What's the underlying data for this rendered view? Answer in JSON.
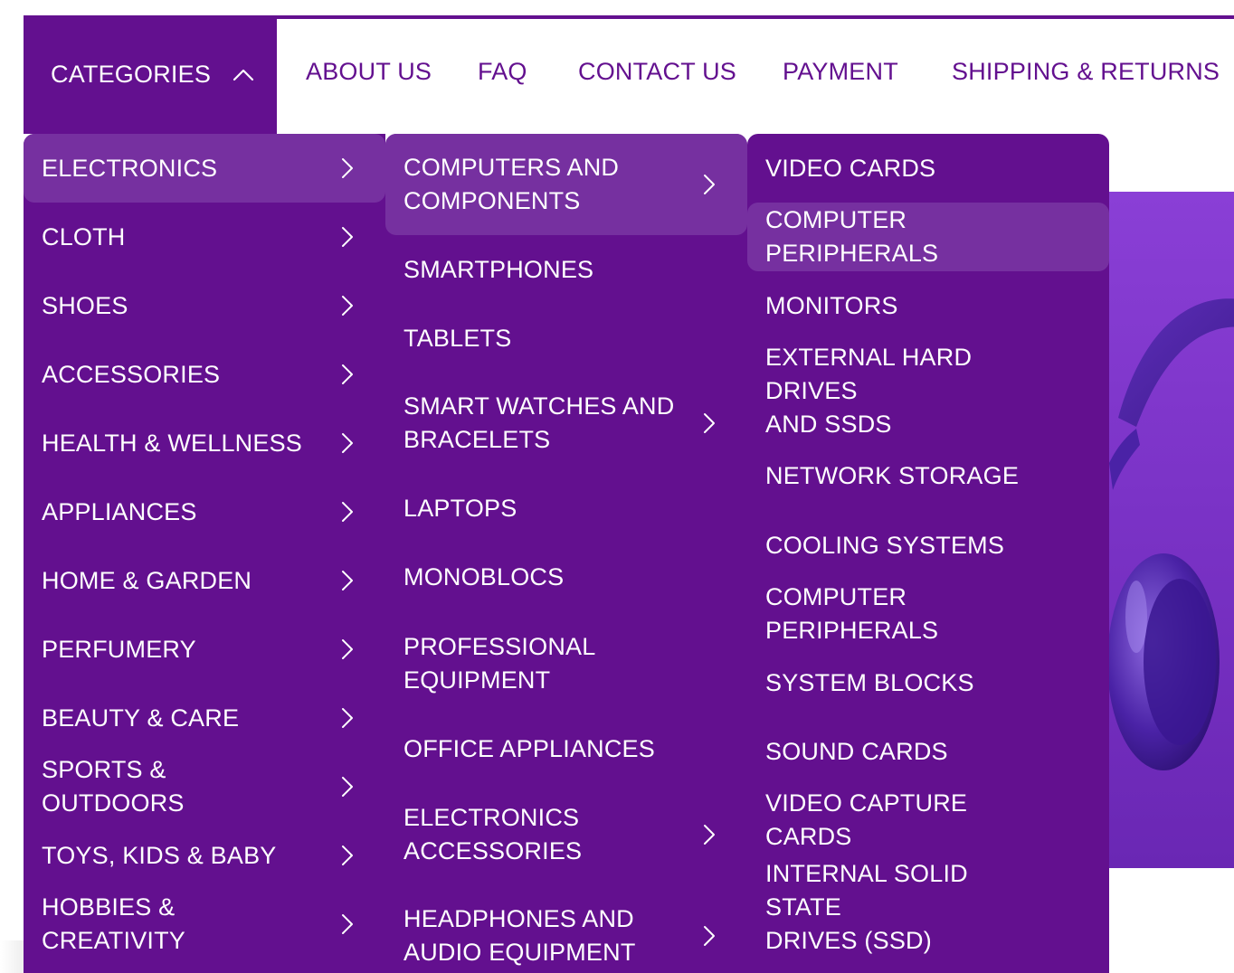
{
  "nav": {
    "categories_label": "CATEGORIES",
    "links": [
      "ABOUT US",
      "FAQ",
      "CONTACT US",
      "PAYMENT",
      "SHIPPING & RETURNS"
    ]
  },
  "menu_level1": {
    "items": [
      {
        "label": "ELECTRONICS",
        "has_submenu": true,
        "active": true
      },
      {
        "label": "CLOTH",
        "has_submenu": true
      },
      {
        "label": "SHOES",
        "has_submenu": true
      },
      {
        "label": "ACCESSORIES",
        "has_submenu": true
      },
      {
        "label": "HEALTH & WELLNESS",
        "has_submenu": true
      },
      {
        "label": "APPLIANCES",
        "has_submenu": true
      },
      {
        "label": "HOME & GARDEN",
        "has_submenu": true
      },
      {
        "label": "PERFUMERY",
        "has_submenu": true
      },
      {
        "label": "BEAUTY & CARE",
        "has_submenu": true
      },
      {
        "label": "SPORTS & OUTDOORS",
        "has_submenu": true
      },
      {
        "label": "TOYS, KIDS & BABY",
        "has_submenu": true
      },
      {
        "label": "HOBBIES & CREATIVITY",
        "has_submenu": true
      }
    ]
  },
  "menu_level2": {
    "items": [
      {
        "label": [
          "COMPUTERS AND",
          "COMPONENTS"
        ],
        "has_submenu": true,
        "active": true
      },
      {
        "label": [
          "SMARTPHONES"
        ],
        "has_submenu": false
      },
      {
        "label": [
          "TABLETS"
        ],
        "has_submenu": false
      },
      {
        "label": [
          "SMART WATCHES AND",
          "BRACELETS"
        ],
        "has_submenu": true
      },
      {
        "label": [
          "LAPTOPS"
        ],
        "has_submenu": false
      },
      {
        "label": [
          "MONOBLOCS"
        ],
        "has_submenu": false
      },
      {
        "label": [
          "PROFESSIONAL",
          "EQUIPMENT"
        ],
        "has_submenu": false
      },
      {
        "label": [
          "OFFICE APPLIANCES"
        ],
        "has_submenu": false
      },
      {
        "label": [
          "ELECTRONICS",
          "ACCESSORIES"
        ],
        "has_submenu": true
      },
      {
        "label": [
          "HEADPHONES AND",
          "AUDIO EQUIPMENT"
        ],
        "has_submenu": true
      }
    ]
  },
  "menu_level3": {
    "items": [
      {
        "label": [
          "VIDEO CARDS"
        ]
      },
      {
        "label": [
          "COMPUTER PERIPHERALS"
        ],
        "active": true
      },
      {
        "label": [
          "MONITORS"
        ]
      },
      {
        "label": [
          "EXTERNAL HARD DRIVES",
          "AND SSDS"
        ]
      },
      {
        "label": [
          "NETWORK STORAGE"
        ]
      },
      {
        "label": [
          "COOLING SYSTEMS"
        ]
      },
      {
        "label": [
          "COMPUTER PERIPHERALS"
        ]
      },
      {
        "label": [
          "SYSTEM BLOCKS"
        ]
      },
      {
        "label": [
          "SOUND CARDS"
        ]
      },
      {
        "label": [
          "VIDEO CAPTURE CARDS"
        ]
      },
      {
        "label": [
          "INTERNAL SOLID STATE",
          "DRIVES (SSD)"
        ]
      }
    ]
  },
  "colors": {
    "brand_purple": "#63108f",
    "active_item": "#7630a0",
    "text_on_purple": "#ffffff"
  },
  "icons": {
    "categories_toggle": "chevron-up-icon",
    "submenu_arrow": "chevron-right-icon"
  }
}
